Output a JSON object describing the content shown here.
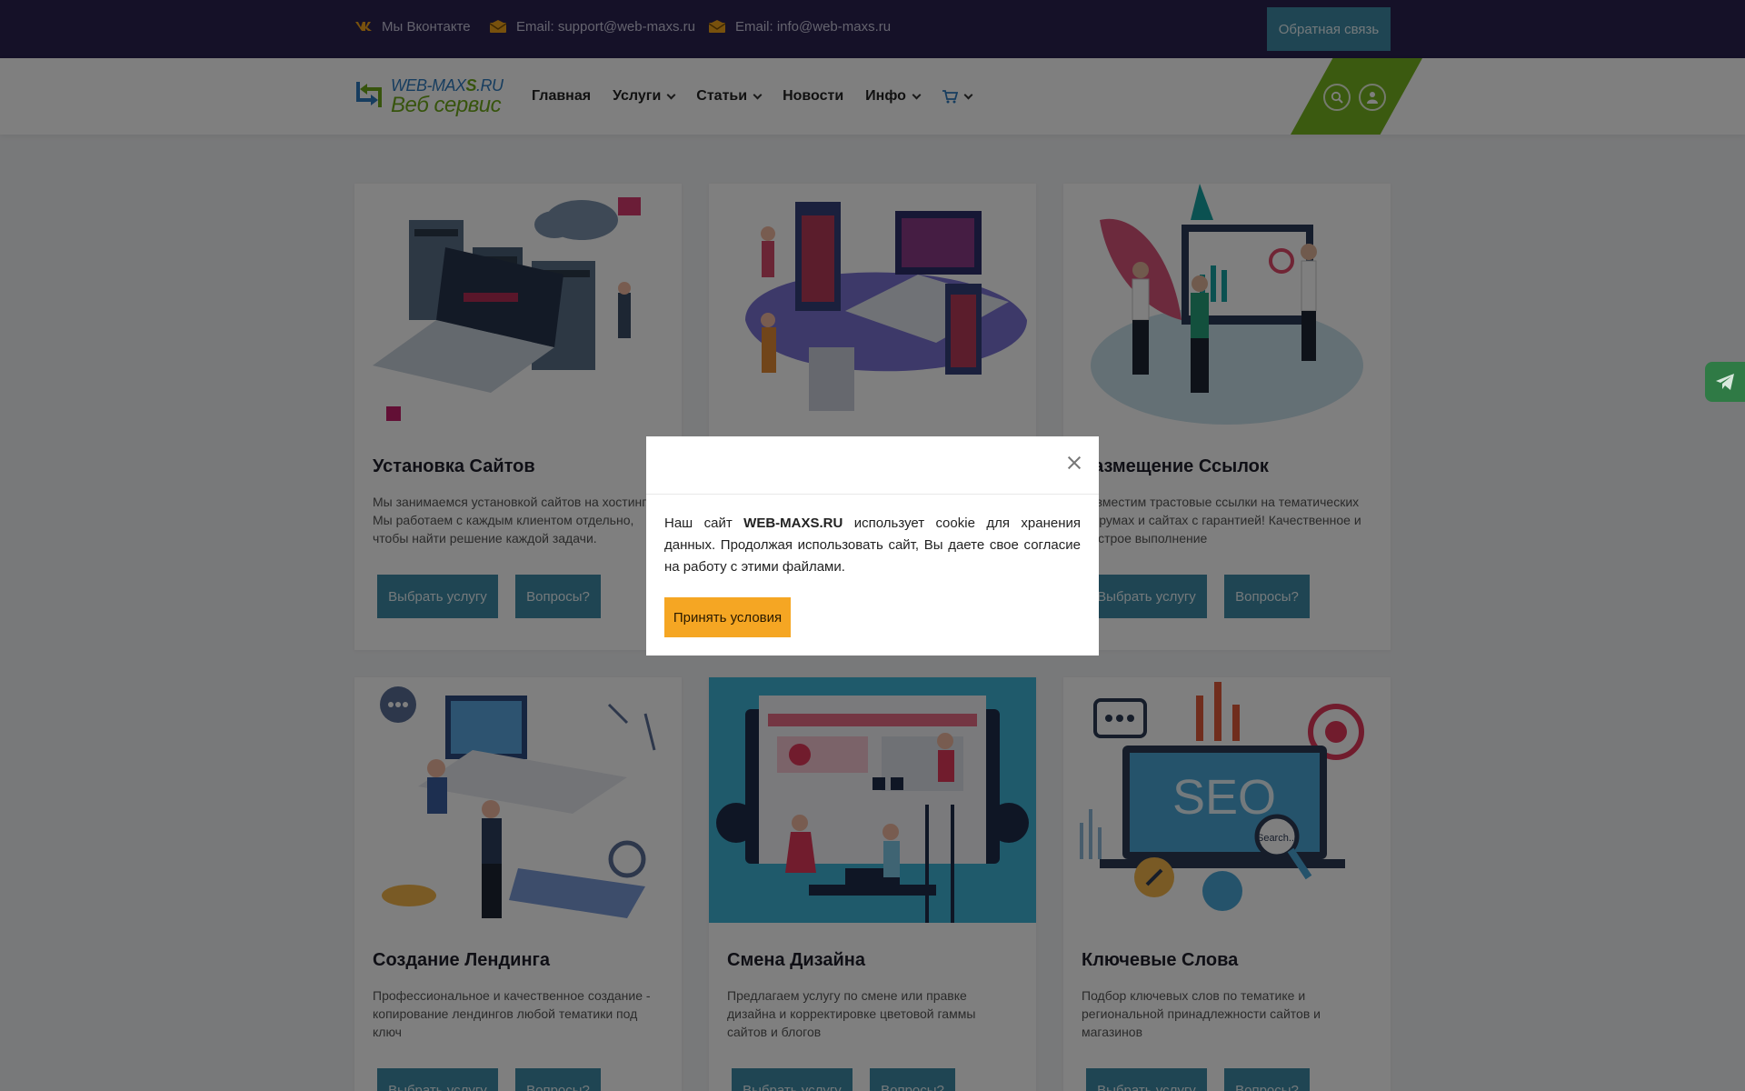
{
  "topbar": {
    "vk": {
      "icon": "vk-icon",
      "label": "Мы Вконтакте"
    },
    "emails": [
      {
        "icon": "envelope-icon",
        "label": "Email: support@web-maxs.ru"
      },
      {
        "icon": "envelope-icon",
        "label": "Email: info@web-maxs.ru"
      }
    ],
    "feedback_label": "Обратная связь"
  },
  "logo": {
    "line1_a": "WEB-MAX",
    "line1_s": "S",
    "line1_b": ".RU",
    "line2": "Веб сервис"
  },
  "nav": {
    "items": [
      {
        "label": "Главная"
      },
      {
        "label": "Услуги"
      },
      {
        "label": "Статьи"
      },
      {
        "label": "Новости"
      },
      {
        "label": "Инфо"
      }
    ],
    "shop_icon": "basket-icon",
    "search_icon": "search-icon",
    "user_icon": "user-icon"
  },
  "cards": [
    {
      "title": "Установка Сайтов",
      "text": "Мы занимаемся установкой сайтов на хостинг. Мы работаем с каждым клиентом отдельно, чтобы найти решение каждой задачи.",
      "btn_primary": "Выбрать услугу",
      "btn_secondary": "Вопросы?"
    },
    {
      "title": "",
      "text": "",
      "btn_primary": "",
      "btn_secondary": ""
    },
    {
      "title": "Размещение Ссылок",
      "text": "Разместим трастовые ссылки на тематических форумах и сайтах с гарантией! Качественное и быстрое выполнение",
      "btn_primary": "Выбрать услугу",
      "btn_secondary": "Вопросы?"
    },
    {
      "title": "Создание Лендинга",
      "text": "Профессиональное и качественное создание - копирование лендингов любой тематики под ключ",
      "btn_primary": "Выбрать услугу",
      "btn_secondary": "Вопросы?"
    },
    {
      "title": "Смена Дизайна",
      "text": "Предлагаем услугу по смене или правке дизайна и корректировке цветовой гаммы сайтов и блогов",
      "btn_primary": "Выбрать услугу",
      "btn_secondary": "Вопросы?"
    },
    {
      "title": "Ключевые Слова",
      "text": "Подбор ключевых слов по тематике и региональной принадлежности сайтов и магазинов",
      "btn_primary": "Выбрать услугу",
      "btn_secondary": "Вопросы?"
    }
  ],
  "illustrations": {
    "seo_label": "SEO",
    "search_label": "Search..."
  },
  "telegram_icon": "telegram-icon",
  "modal": {
    "text_before": "Наш сайт ",
    "site": "WEB-MAXS.RU",
    "text_after": " использует cookie для хранения данных. Продолжая использовать сайт, Вы даете свое согласие на работу с этими файлами.",
    "accept_label": "Принять условия",
    "close_icon": "close-icon"
  },
  "colors": {
    "topbar": "#2a2250",
    "accent": "#3e8ba6",
    "green": "#77b520",
    "accept": "#f5a623"
  }
}
